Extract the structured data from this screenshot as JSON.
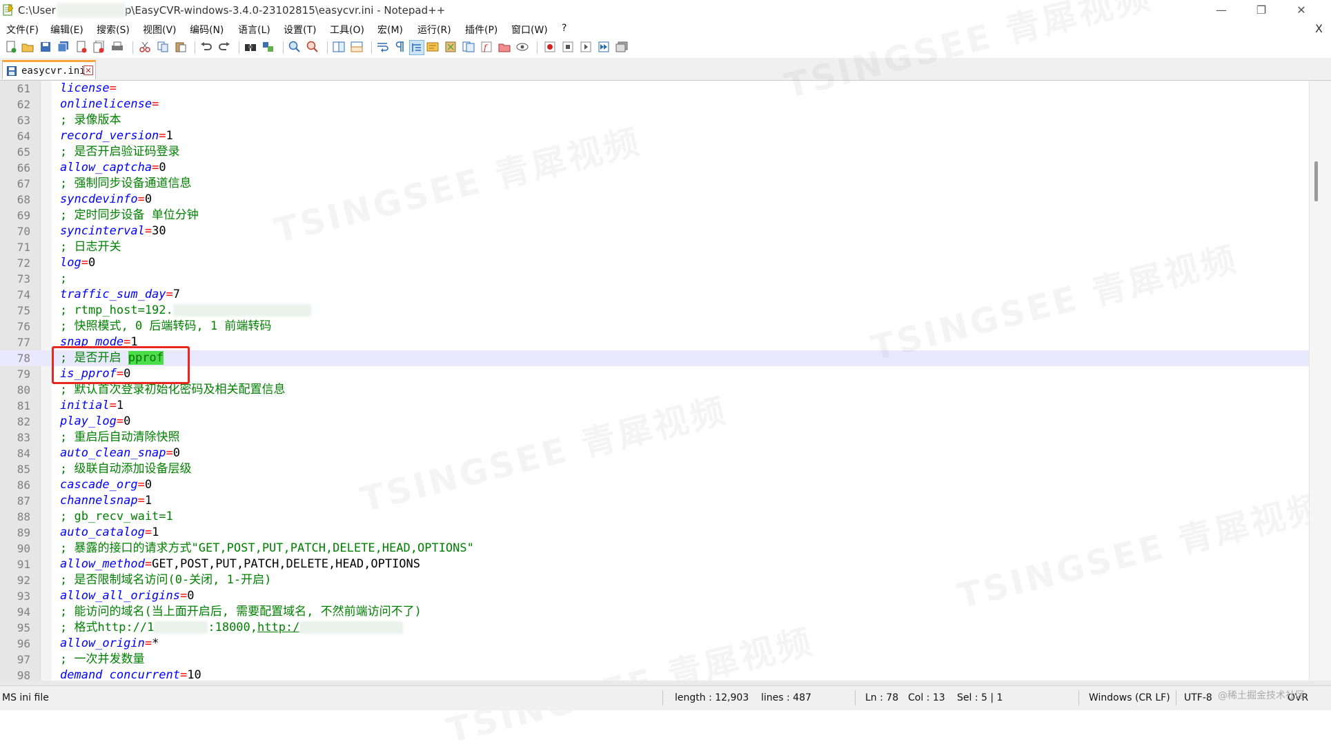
{
  "window": {
    "title_prefix": "C:\\User",
    "title_suffix": "p\\EasyCVR-windows-3.4.0-23102815\\easycvr.ini - Notepad++",
    "minimize": "—",
    "restore": "❐",
    "close": "✕"
  },
  "menu": {
    "items": [
      "文件(F)",
      "编辑(E)",
      "搜索(S)",
      "视图(V)",
      "编码(N)",
      "语言(L)",
      "设置(T)",
      "工具(O)",
      "宏(M)",
      "运行(R)",
      "插件(P)",
      "窗口(W)",
      "?"
    ],
    "close_doc": "X"
  },
  "tab": {
    "label": "easycvr.ini",
    "close": "✕"
  },
  "editor": {
    "current_line": 78,
    "lines": [
      {
        "n": "61",
        "key": "license",
        "eq": "=",
        "val": ""
      },
      {
        "n": "62",
        "key": "onlinelicense",
        "eq": "=",
        "val": ""
      },
      {
        "n": "63",
        "comment": "; 录像版本"
      },
      {
        "n": "64",
        "key": "record_version",
        "eq": "=",
        "val": "1"
      },
      {
        "n": "65",
        "comment": "; 是否开启验证码登录"
      },
      {
        "n": "66",
        "key": "allow_captcha",
        "eq": "=",
        "val": "0"
      },
      {
        "n": "67",
        "comment": "; 强制同步设备通道信息"
      },
      {
        "n": "68",
        "key": "syncdevinfo",
        "eq": "=",
        "val": "0"
      },
      {
        "n": "69",
        "comment": "; 定时同步设备 单位分钟"
      },
      {
        "n": "70",
        "key": "syncinterval",
        "eq": "=",
        "val": "30"
      },
      {
        "n": "71",
        "comment": "; 日志开关"
      },
      {
        "n": "72",
        "key": "log",
        "eq": "=",
        "val": "0"
      },
      {
        "n": "73",
        "comment": ";"
      },
      {
        "n": "74",
        "key": "traffic_sum_day",
        "eq": "=",
        "val": "7"
      },
      {
        "n": "75",
        "comment": "; rtmp_host=192."
      },
      {
        "n": "76",
        "comment": "; 快照模式, 0 后端转码, 1 前端转码"
      },
      {
        "n": "77",
        "key": "snap_mode",
        "eq": "=",
        "val": "1"
      },
      {
        "n": "78",
        "comment": "; 是否开启 ",
        "highlight": "pprof"
      },
      {
        "n": "79",
        "key": "is_pprof",
        "eq": "=",
        "val": "0"
      },
      {
        "n": "80",
        "comment": "; 默认首次登录初始化密码及相关配置信息"
      },
      {
        "n": "81",
        "key": "initial",
        "eq": "=",
        "val": "1"
      },
      {
        "n": "82",
        "key": "play_log",
        "eq": "=",
        "val": "0"
      },
      {
        "n": "83",
        "comment": "; 重启后自动清除快照"
      },
      {
        "n": "84",
        "key": "auto_clean_snap",
        "eq": "=",
        "val": "0"
      },
      {
        "n": "85",
        "comment": "; 级联自动添加设备层级"
      },
      {
        "n": "86",
        "key": "cascade_org",
        "eq": "=",
        "val": "0"
      },
      {
        "n": "87",
        "key": "channelsnap",
        "eq": "=",
        "val": "1"
      },
      {
        "n": "88",
        "comment": "; gb_recv_wait=1"
      },
      {
        "n": "89",
        "key": "auto_catalog",
        "eq": "=",
        "val": "1"
      },
      {
        "n": "90",
        "comment": "; 暴露的接口的请求方式\"GET,POST,PUT,PATCH,DELETE,HEAD,OPTIONS\""
      },
      {
        "n": "91",
        "key": "allow_method",
        "eq": "=",
        "val": "GET,POST,PUT,PATCH,DELETE,HEAD,OPTIONS"
      },
      {
        "n": "92",
        "comment": "; 是否限制域名访问(0-关闭, 1-开启)"
      },
      {
        "n": "93",
        "key": "allow_all_origins",
        "eq": "=",
        "val": "0"
      },
      {
        "n": "94",
        "comment": "; 能访问的域名(当上面开启后, 需要配置域名, 不然前端访问不了)"
      },
      {
        "n": "95",
        "comment": "; 格式http://1",
        "after_blur": ":18000,",
        "link": "http:/"
      },
      {
        "n": "96",
        "key": "allow_origin",
        "eq": "=",
        "val": "*"
      },
      {
        "n": "97",
        "comment": "; 一次并发数量"
      },
      {
        "n": "98",
        "key": "demand_concurrent",
        "eq": "=",
        "val": "10"
      }
    ]
  },
  "status": {
    "file_type": "MS ini file",
    "length": "length : 12,903",
    "lines": "lines : 487",
    "ln": "Ln : 78",
    "col": "Col : 13",
    "sel": "Sel : 5 | 1",
    "eol": "Windows (CR LF)",
    "encoding": "UTF-8",
    "mode": "OVR"
  },
  "watermarks": [
    "TSINGSEE 青犀视频",
    "TSINGSEE 青犀视频",
    "TSINGSEE 青犀视频",
    "TSINGSEE 青犀视频",
    "TSINGSEE 青犀视频",
    "TSINGSEE 青犀视频"
  ],
  "corner_mark": "@稀土掘金技术社区"
}
